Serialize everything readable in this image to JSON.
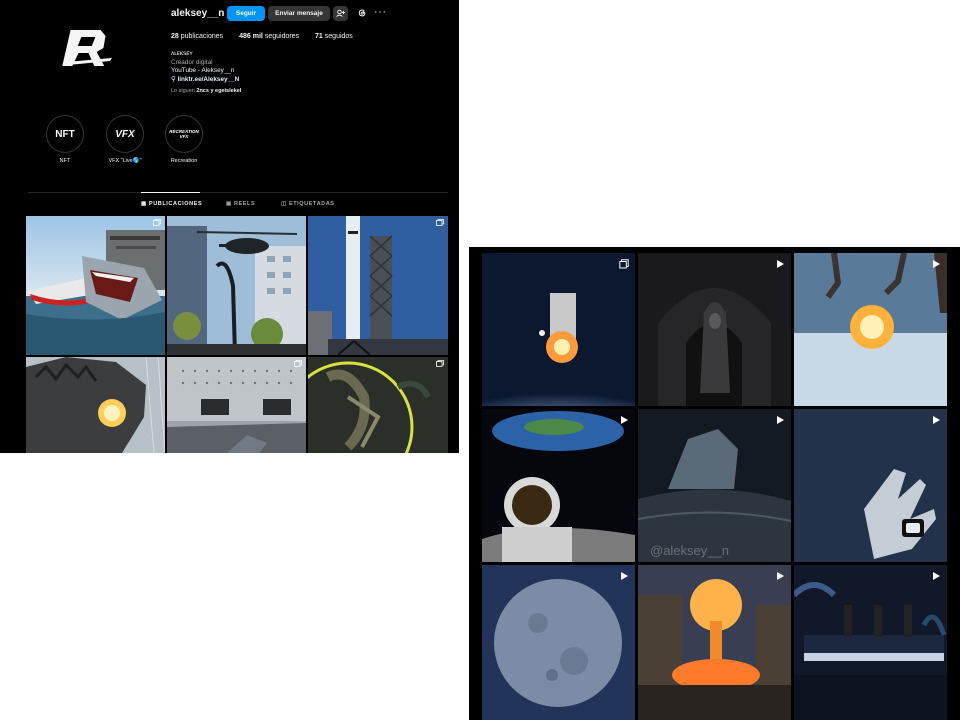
{
  "profile": {
    "username": "aleksey__n",
    "actions": {
      "follow": "Seguir",
      "message": "Enviar mensaje",
      "more": "···"
    },
    "stats": {
      "posts_count": "28",
      "posts_label": "publicaciones",
      "followers_count": "486 mil",
      "followers_label": "seguidores",
      "following_count": "71",
      "following_label": "seguidos"
    },
    "bio": {
      "name": "ʌʟᴇᴋsᴇʏ",
      "category": "Creador digital",
      "line1": "YouTube - Aleksey__n",
      "link": "linktr.ee/Aleksey__N"
    },
    "followed_by": {
      "prefix": "Lo siguen",
      "names": "2ncs y egeislekel"
    },
    "highlights": [
      {
        "cover": "NFT",
        "label": "NFT"
      },
      {
        "cover": "VFX",
        "label": "VFX \"Live🌎\""
      },
      {
        "cover": "RECREATION VFX",
        "label": "Recreation"
      }
    ],
    "tabs": [
      {
        "label": "PUBLICACIONES",
        "icon": "grid-icon"
      },
      {
        "label": "REELS",
        "icon": "reels-icon"
      },
      {
        "label": "ETIQUETADAS",
        "icon": "tagged-icon"
      }
    ],
    "posts": [
      {
        "scene": "shark attacking yacht",
        "type": "carousel"
      },
      {
        "scene": "helicopter over city",
        "type": "none"
      },
      {
        "scene": "rocket launch tower",
        "type": "carousel"
      },
      {
        "scene": "godzilla atomic breath",
        "type": "none"
      },
      {
        "scene": "ship hull with shark",
        "type": "carousel"
      },
      {
        "scene": "creature in portal",
        "type": "carousel"
      }
    ]
  },
  "reels": {
    "items": [
      {
        "scene": "explosion above earth",
        "type": "carousel"
      },
      {
        "scene": "hooded figure in tunnel",
        "type": "reel"
      },
      {
        "scene": "robot claws explosion",
        "type": "reel"
      },
      {
        "scene": "astronaut on moon with earth",
        "type": "reel"
      },
      {
        "scene": "godzilla emerging from ocean",
        "type": "reel",
        "watermark": "@aleksey__n"
      },
      {
        "scene": "hand with smartwatch",
        "type": "reel"
      },
      {
        "scene": "full moon",
        "type": "reel"
      },
      {
        "scene": "nuclear mushroom cloud in city",
        "type": "reel"
      },
      {
        "scene": "titanic ship with kraken",
        "type": "reel"
      }
    ]
  },
  "colors": {
    "accent": "#0095f6",
    "background": "#000000",
    "muted": "#a8a8a8"
  }
}
